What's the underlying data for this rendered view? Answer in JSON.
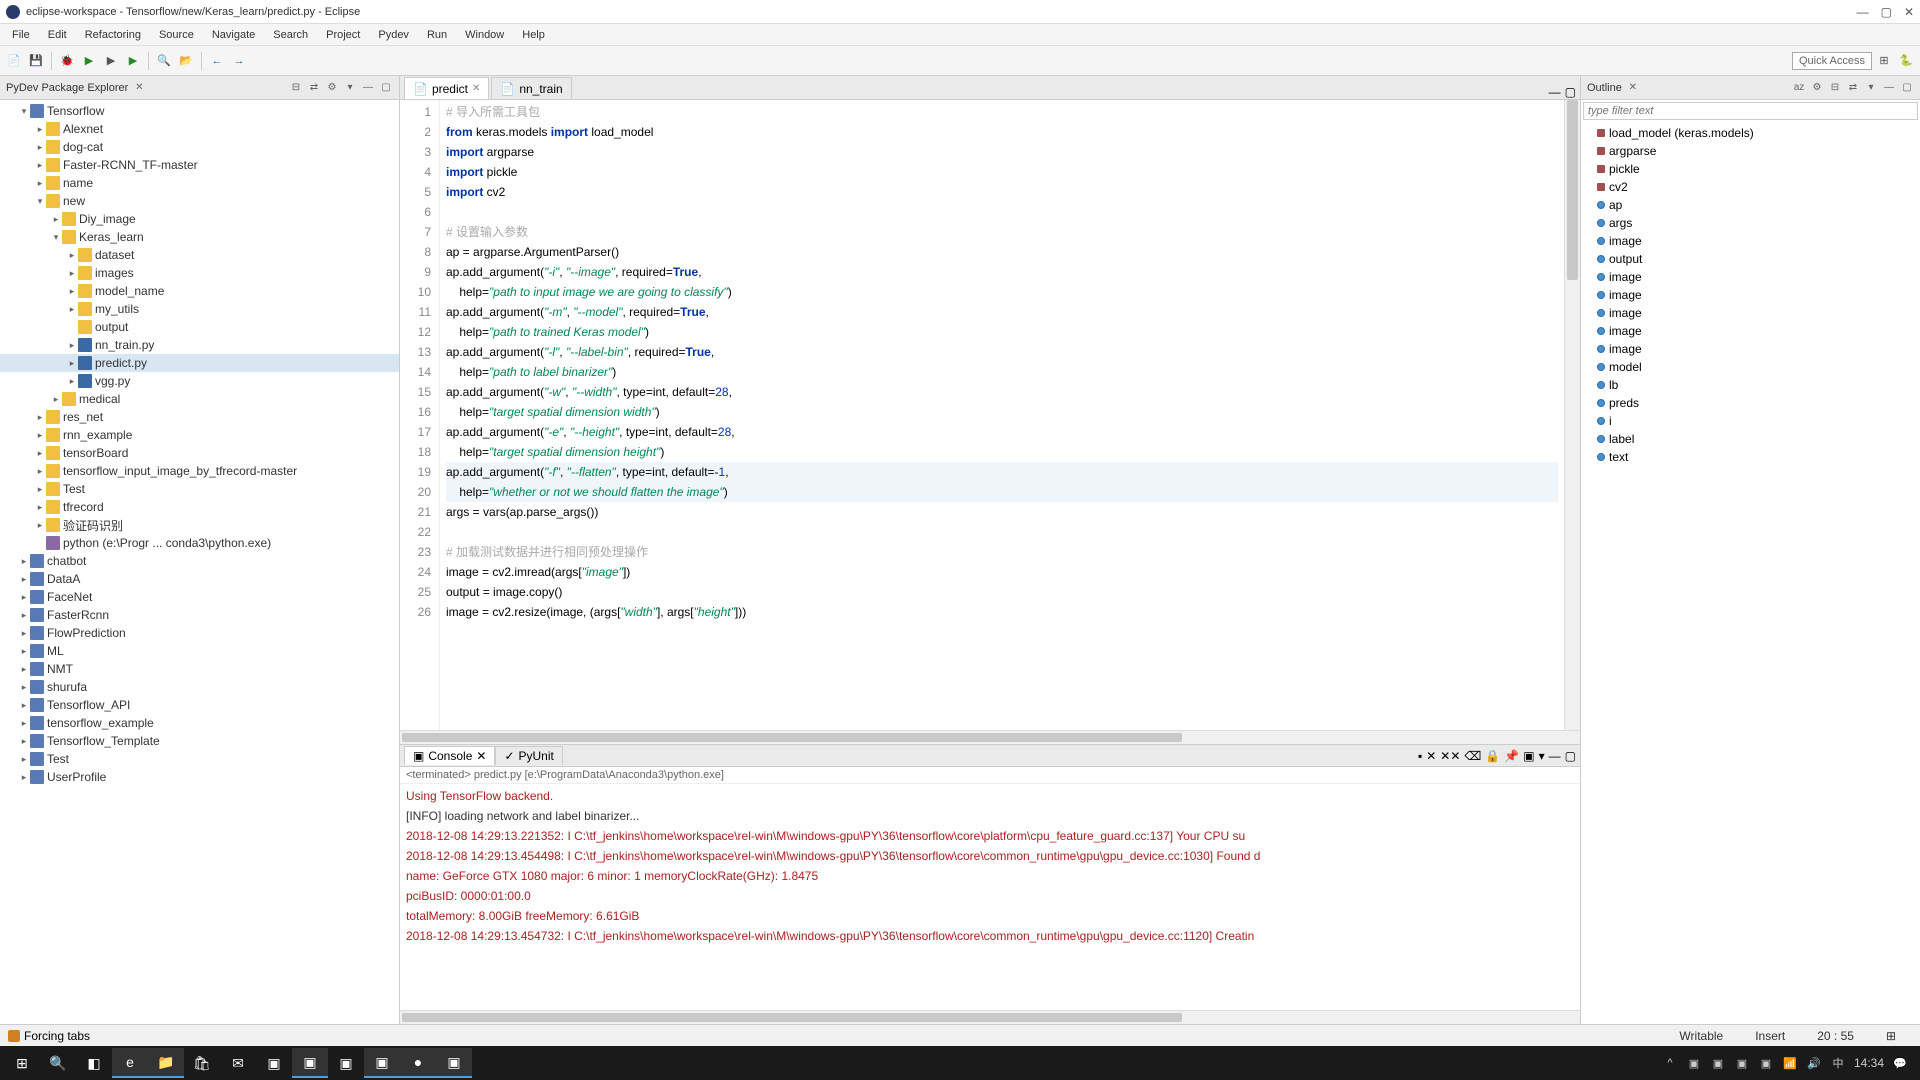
{
  "window": {
    "title": "eclipse-workspace - Tensorflow/new/Keras_learn/predict.py - Eclipse"
  },
  "menu": {
    "items": [
      "File",
      "Edit",
      "Refactoring",
      "Source",
      "Navigate",
      "Search",
      "Project",
      "Pydev",
      "Run",
      "Window",
      "Help"
    ]
  },
  "toolbar": {
    "quick": "Quick Access"
  },
  "explorer": {
    "title": "PyDev Package Explorer",
    "items": [
      {
        "l": 1,
        "t": "▾",
        "i": "folder-b",
        "n": "Tensorflow"
      },
      {
        "l": 2,
        "t": "▸",
        "i": "folder",
        "n": "Alexnet"
      },
      {
        "l": 2,
        "t": "▸",
        "i": "folder",
        "n": "dog-cat"
      },
      {
        "l": 2,
        "t": "▸",
        "i": "folder",
        "n": "Faster-RCNN_TF-master"
      },
      {
        "l": 2,
        "t": "▸",
        "i": "folder",
        "n": "name"
      },
      {
        "l": 2,
        "t": "▾",
        "i": "folder",
        "n": "new"
      },
      {
        "l": 3,
        "t": "▸",
        "i": "folder",
        "n": "Diy_image"
      },
      {
        "l": 3,
        "t": "▾",
        "i": "folder",
        "n": "Keras_learn"
      },
      {
        "l": 4,
        "t": "▸",
        "i": "folder",
        "n": "dataset"
      },
      {
        "l": 4,
        "t": "▸",
        "i": "folder",
        "n": "images"
      },
      {
        "l": 4,
        "t": "▸",
        "i": "folder",
        "n": "model_name"
      },
      {
        "l": 4,
        "t": "▸",
        "i": "folder",
        "n": "my_utils"
      },
      {
        "l": 4,
        "t": "",
        "i": "folder",
        "n": "output"
      },
      {
        "l": 4,
        "t": "▸",
        "i": "py",
        "n": "nn_train.py"
      },
      {
        "l": 4,
        "t": "▸",
        "i": "py",
        "n": "predict.py",
        "sel": true
      },
      {
        "l": 4,
        "t": "▸",
        "i": "py",
        "n": "vgg.py"
      },
      {
        "l": 3,
        "t": "▸",
        "i": "folder",
        "n": "medical"
      },
      {
        "l": 2,
        "t": "▸",
        "i": "folder",
        "n": "res_net"
      },
      {
        "l": 2,
        "t": "▸",
        "i": "folder",
        "n": "rnn_example"
      },
      {
        "l": 2,
        "t": "▸",
        "i": "folder",
        "n": "tensorBoard"
      },
      {
        "l": 2,
        "t": "▸",
        "i": "folder",
        "n": "tensorflow_input_image_by_tfrecord-master"
      },
      {
        "l": 2,
        "t": "▸",
        "i": "folder",
        "n": "Test"
      },
      {
        "l": 2,
        "t": "▸",
        "i": "folder",
        "n": "tfrecord"
      },
      {
        "l": 2,
        "t": "▸",
        "i": "folder",
        "n": "验证码识别"
      },
      {
        "l": 2,
        "t": "",
        "i": "purple",
        "n": "python  (e:\\Progr ... conda3\\python.exe)"
      },
      {
        "l": 1,
        "t": "▸",
        "i": "folder-b",
        "n": "chatbot"
      },
      {
        "l": 1,
        "t": "▸",
        "i": "folder-b",
        "n": "DataA"
      },
      {
        "l": 1,
        "t": "▸",
        "i": "folder-b",
        "n": "FaceNet"
      },
      {
        "l": 1,
        "t": "▸",
        "i": "folder-b",
        "n": "FasterRcnn"
      },
      {
        "l": 1,
        "t": "▸",
        "i": "folder-b",
        "n": "FlowPrediction"
      },
      {
        "l": 1,
        "t": "▸",
        "i": "folder-b",
        "n": "ML"
      },
      {
        "l": 1,
        "t": "▸",
        "i": "folder-b",
        "n": "NMT"
      },
      {
        "l": 1,
        "t": "▸",
        "i": "folder-b",
        "n": "shurufa"
      },
      {
        "l": 1,
        "t": "▸",
        "i": "folder-b",
        "n": "Tensorflow_API"
      },
      {
        "l": 1,
        "t": "▸",
        "i": "folder-b",
        "n": "tensorflow_example"
      },
      {
        "l": 1,
        "t": "▸",
        "i": "folder-b",
        "n": "Tensorflow_Template"
      },
      {
        "l": 1,
        "t": "▸",
        "i": "folder-b",
        "n": "Test"
      },
      {
        "l": 1,
        "t": "▸",
        "i": "folder-b",
        "n": "UserProfile"
      }
    ]
  },
  "tabs": {
    "active": "predict",
    "inactive": "nn_train"
  },
  "code_lines": [
    {
      "n": 1,
      "h": "<span class='com'># 导入所需工具包</span>"
    },
    {
      "n": 2,
      "h": "<span class='kw'>from</span> keras.models <span class='kw'>import</span> load_model"
    },
    {
      "n": 3,
      "h": "<span class='kw'>import</span> argparse"
    },
    {
      "n": 4,
      "h": "<span class='kw'>import</span> pickle"
    },
    {
      "n": 5,
      "h": "<span class='kw'>import</span> cv2"
    },
    {
      "n": 6,
      "h": ""
    },
    {
      "n": 7,
      "h": "<span class='com'># 设置输入参数</span>"
    },
    {
      "n": 8,
      "h": "ap = argparse.ArgumentParser()"
    },
    {
      "n": 9,
      "h": "ap.add_argument(<span class='str'>\"-i\"</span>, <span class='str'>\"--image\"</span>, required=<span class='kw'>True</span>,"
    },
    {
      "n": 10,
      "h": "    help=<span class='str'>\"path to input image we are going to classify\"</span>)"
    },
    {
      "n": 11,
      "h": "ap.add_argument(<span class='str'>\"-m\"</span>, <span class='str'>\"--model\"</span>, required=<span class='kw'>True</span>,"
    },
    {
      "n": 12,
      "h": "    help=<span class='str'>\"path to trained Keras model\"</span>)"
    },
    {
      "n": 13,
      "h": "ap.add_argument(<span class='str'>\"-l\"</span>, <span class='str'>\"--label-bin\"</span>, required=<span class='kw'>True</span>,"
    },
    {
      "n": 14,
      "h": "    help=<span class='str'>\"path to label binarizer\"</span>)"
    },
    {
      "n": 15,
      "h": "ap.add_argument(<span class='str'>\"-w\"</span>, <span class='str'>\"--width\"</span>, type=int, default=<span class='num'>28</span>,"
    },
    {
      "n": 16,
      "h": "    help=<span class='str'>\"target spatial dimension width\"</span>)"
    },
    {
      "n": 17,
      "h": "ap.add_argument(<span class='str'>\"-e\"</span>, <span class='str'>\"--height\"</span>, type=int, default=<span class='num'>28</span>,"
    },
    {
      "n": 18,
      "h": "    help=<span class='str'>\"target spatial dimension height\"</span>)"
    },
    {
      "n": 19,
      "h": "ap.add_argument(<span class='str'>\"-f\"</span>, <span class='str'>\"--flatten\"</span>, type=int, default=-<span class='num'>1</span>,",
      "hl": true
    },
    {
      "n": 20,
      "h": "    help=<span class='str'>\"whether or not we should flatten the image\"</span>)",
      "hl": true
    },
    {
      "n": 21,
      "h": "args = vars(ap.parse_args())"
    },
    {
      "n": 22,
      "h": ""
    },
    {
      "n": 23,
      "h": "<span class='com'># 加载测试数据并进行相同预处理操作</span>"
    },
    {
      "n": 24,
      "h": "image = cv2.imread(args[<span class='str'>\"image\"</span>])"
    },
    {
      "n": 25,
      "h": "output = image.copy()"
    },
    {
      "n": 26,
      "h": "image = cv2.resize(image, (args[<span class='str'>\"width\"</span>], args[<span class='str'>\"height\"</span>]))"
    }
  ],
  "console": {
    "tab1": "Console",
    "tab2": "PyUnit",
    "sub": "<terminated> predict.py [e:\\ProgramData\\Anaconda3\\python.exe]",
    "lines": [
      {
        "c": "err",
        "t": "Using TensorFlow backend."
      },
      {
        "c": "inf",
        "t": "[INFO] loading network and label binarizer..."
      },
      {
        "c": "err",
        "t": "2018-12-08 14:29:13.221352: I C:\\tf_jenkins\\home\\workspace\\rel-win\\M\\windows-gpu\\PY\\36\\tensorflow\\core\\platform\\cpu_feature_guard.cc:137] Your CPU su"
      },
      {
        "c": "err",
        "t": "2018-12-08 14:29:13.454498: I C:\\tf_jenkins\\home\\workspace\\rel-win\\M\\windows-gpu\\PY\\36\\tensorflow\\core\\common_runtime\\gpu\\gpu_device.cc:1030] Found d"
      },
      {
        "c": "err",
        "t": "name: GeForce GTX 1080 major: 6 minor: 1 memoryClockRate(GHz): 1.8475"
      },
      {
        "c": "err",
        "t": "pciBusID: 0000:01:00.0"
      },
      {
        "c": "err",
        "t": "totalMemory: 8.00GiB freeMemory: 6.61GiB"
      },
      {
        "c": "err",
        "t": "2018-12-08 14:29:13.454732: I C:\\tf_jenkins\\home\\workspace\\rel-win\\M\\windows-gpu\\PY\\36\\tensorflow\\core\\common_runtime\\gpu\\gpu_device.cc:1120] Creatin"
      }
    ]
  },
  "outline": {
    "title": "Outline",
    "filter": "type filter text",
    "items": [
      {
        "i": "r",
        "n": "load_model (keras.models)"
      },
      {
        "i": "r",
        "n": "argparse"
      },
      {
        "i": "r",
        "n": "pickle"
      },
      {
        "i": "r",
        "n": "cv2"
      },
      {
        "i": "d",
        "n": "ap"
      },
      {
        "i": "d",
        "n": "args"
      },
      {
        "i": "d",
        "n": "image"
      },
      {
        "i": "d",
        "n": "output"
      },
      {
        "i": "d",
        "n": "image"
      },
      {
        "i": "d",
        "n": "image"
      },
      {
        "i": "d",
        "n": "image"
      },
      {
        "i": "d",
        "n": "image"
      },
      {
        "i": "d",
        "n": "image"
      },
      {
        "i": "d",
        "n": "model"
      },
      {
        "i": "d",
        "n": "lb"
      },
      {
        "i": "d",
        "n": "preds"
      },
      {
        "i": "d",
        "n": "i"
      },
      {
        "i": "d",
        "n": "label"
      },
      {
        "i": "d",
        "n": "text"
      }
    ]
  },
  "status": {
    "msg": "Forcing tabs",
    "writable": "Writable",
    "insert": "Insert",
    "pos": "20 : 55"
  },
  "taskbar": {
    "time": "14:34"
  }
}
